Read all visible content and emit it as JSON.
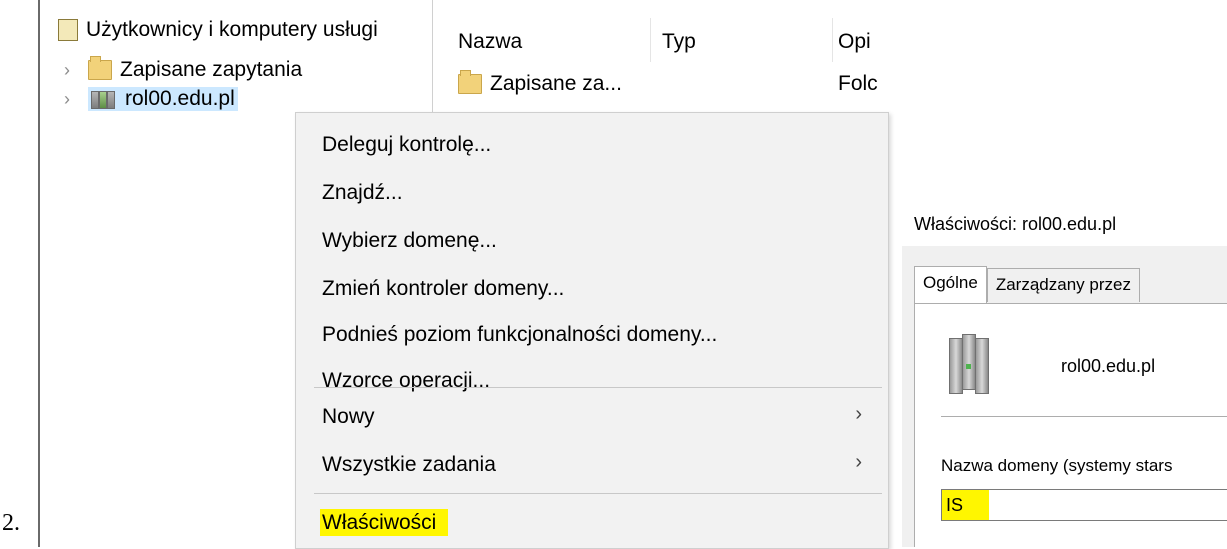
{
  "doc_number": "2.",
  "tree": {
    "root_label": "Użytkownicy i komputery usługi",
    "items": [
      {
        "label": "Zapisane zapytania"
      },
      {
        "label": "rol00.edu.pl"
      }
    ]
  },
  "list": {
    "columns": [
      "Nazwa",
      "Typ",
      "Opi"
    ],
    "rows": [
      {
        "name": "Zapisane za...",
        "type": "Folc"
      }
    ]
  },
  "context_menu": {
    "items": [
      {
        "label": "Deleguj kontrolę..."
      },
      {
        "label": "Znajdź..."
      },
      {
        "label": "Wybierz domenę..."
      },
      {
        "label": "Zmień kontroler domeny..."
      },
      {
        "label": "Podnieś poziom funkcjonalności domeny..."
      },
      {
        "label": "Wzorce operacji..."
      },
      {
        "label": "Nowy",
        "submenu": true
      },
      {
        "label": "Wszystkie zadania",
        "submenu": true
      },
      {
        "label": "Właściwości",
        "highlighted": true
      }
    ],
    "submenu_arrow": "›",
    "highlight_color": "#fff600"
  },
  "properties": {
    "title": "Właściwości: rol00.edu.pl",
    "tabs": [
      "Ogólne",
      "Zarządzany przez"
    ],
    "active_tab": "Ogólne",
    "domain_name": "rol00.edu.pl",
    "field_label": "Nazwa domeny (systemy stars",
    "field_value": "IS"
  },
  "icons": {
    "tree_root": "snapin-book-icon",
    "folder": "folder-icon",
    "domain": "domain-icon",
    "expand": "chevron-right-icon",
    "server": "server-icon"
  },
  "colors": {
    "selection": "#cce8ff",
    "menu_bg": "#f2f2f2",
    "highlight": "#fff600"
  }
}
